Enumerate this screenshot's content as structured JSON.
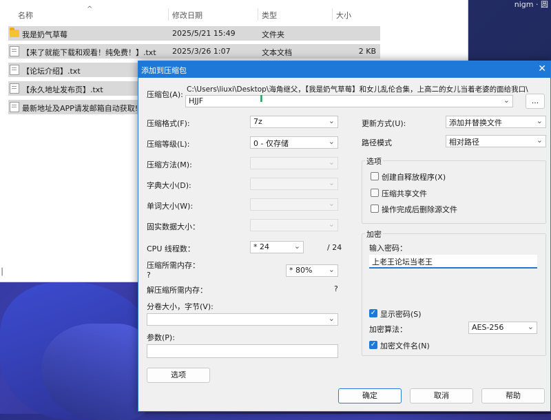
{
  "wallpaper": {
    "corner_text": "nigm · 圆"
  },
  "explorer": {
    "columns": {
      "name": "名称",
      "date": "修改日期",
      "type": "类型",
      "size": "大小"
    },
    "files": [
      {
        "name": "我是奶气草莓",
        "date": "2025/5/21 15:49",
        "type": "文件夹",
        "size": "",
        "icon": "folder-icon"
      },
      {
        "name": "【来了就能下载和观看！纯免费！】.txt",
        "date": "2025/3/26 1:07",
        "type": "文本文档",
        "size": "2 KB",
        "icon": "text-file-icon"
      },
      {
        "name": "【论坛介绍】.txt",
        "date": "",
        "type": "",
        "size": "",
        "icon": "text-file-icon"
      },
      {
        "name": "【永久地址发布页】.txt",
        "date": "",
        "type": "",
        "size": "",
        "icon": "text-file-icon"
      },
      {
        "name": "最新地址及APP请发邮箱自动获取!",
        "date": "",
        "type": "",
        "size": "",
        "icon": "text-file-icon"
      }
    ],
    "edge_char": "│"
  },
  "dialog": {
    "title": "添加到压缩包",
    "close_glyph": "✕",
    "archive": {
      "label": "压缩包(A):",
      "path": "C:\\Users\\liuxi\\Desktop\\海角继父，【我是奶气草莓】和女儿乱伦合集，上高二的女儿当着老婆的面给我口\\",
      "name": "HJJF",
      "browse_label": "..."
    },
    "left": {
      "format_label": "压缩格式(F):",
      "format_value": "7z",
      "level_label": "压缩等级(L):",
      "level_value": "0 - 仅存储",
      "method_label": "压缩方法(M):",
      "dict_label": "字典大小(D):",
      "word_label": "单词大小(W):",
      "solid_label": "固实数据大小：",
      "cpu_label": "CPU 线程数：",
      "cpu_value": "* 24",
      "cpu_max": "/ 24",
      "mem_label": "压缩所需内存：",
      "mem_q": "?",
      "mem_value": "* 80%",
      "decomp_label": "解压缩所需内存：",
      "decomp_q": "?",
      "split_label": "分卷大小，字节(V):",
      "params_label": "参数(P):",
      "options_button": "选项"
    },
    "right": {
      "update_label": "更新方式(U):",
      "update_value": "添加并替换文件",
      "path_label": "路径模式",
      "path_value": "相对路径",
      "options_title": "选项",
      "opt_sfx": "创建自释放程序(X)",
      "opt_shared": "压缩共享文件",
      "opt_delete": "操作完成后删除源文件",
      "enc_title": "加密",
      "pw_label": "输入密码：",
      "pw_value": "上老王论坛当老王",
      "show_pw": "显示密码(S)",
      "algo_label": "加密算法：",
      "algo_value": "AES-256",
      "enc_names": "加密文件名(N)"
    },
    "buttons": {
      "ok": "确定",
      "cancel": "取消",
      "help": "帮助"
    },
    "check_glyph": "✓",
    "arrow_glyph": "⌄"
  }
}
